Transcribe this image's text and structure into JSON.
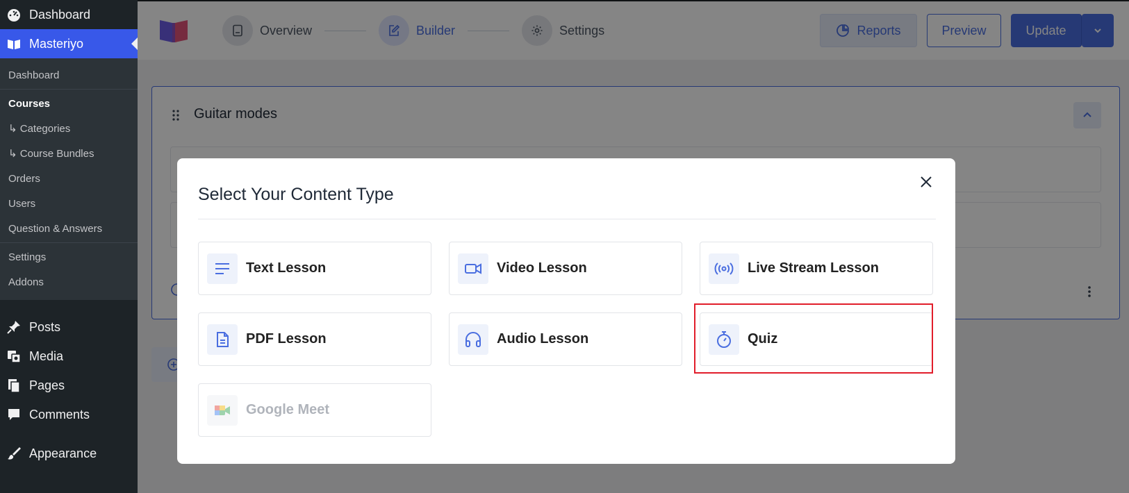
{
  "sidebar": {
    "top": [
      {
        "label": "Dashboard",
        "icon": "dashboard-icon"
      },
      {
        "label": "Masteriyo",
        "icon": "book-icon",
        "current": true
      }
    ],
    "submenu": [
      {
        "label": "Dashboard"
      },
      {
        "label": "Courses",
        "active": true
      },
      {
        "label": "↳ Categories"
      },
      {
        "label": "↳ Course Bundles"
      },
      {
        "label": "Orders"
      },
      {
        "label": "Users"
      },
      {
        "label": "Question & Answers"
      },
      {
        "label": "Settings"
      },
      {
        "label": "Addons"
      }
    ],
    "bottom": [
      {
        "label": "Posts",
        "icon": "pin-icon"
      },
      {
        "label": "Media",
        "icon": "media-icon"
      },
      {
        "label": "Pages",
        "icon": "pages-icon"
      },
      {
        "label": "Comments",
        "icon": "comment-icon"
      },
      {
        "label": "Appearance",
        "icon": "brush-icon"
      }
    ]
  },
  "header": {
    "steps": [
      {
        "label": "Overview",
        "icon": "document-icon"
      },
      {
        "label": "Builder",
        "icon": "edit-icon",
        "active": true
      },
      {
        "label": "Settings",
        "icon": "gear-icon"
      }
    ],
    "reports_label": "Reports",
    "preview_label": "Preview",
    "update_label": "Update"
  },
  "builder": {
    "section_title": "Guitar modes"
  },
  "modal": {
    "title": "Select Your Content Type",
    "options": [
      {
        "label": "Text Lesson",
        "icon": "text-lines-icon"
      },
      {
        "label": "Video Lesson",
        "icon": "video-camera-icon"
      },
      {
        "label": "Live Stream Lesson",
        "icon": "broadcast-icon"
      },
      {
        "label": "PDF Lesson",
        "icon": "pdf-file-icon"
      },
      {
        "label": "Audio Lesson",
        "icon": "headphones-icon"
      },
      {
        "label": "Quiz",
        "icon": "stopwatch-icon",
        "highlighted": true
      },
      {
        "label": "Google Meet",
        "icon": "google-meet-icon",
        "disabled": true
      }
    ]
  },
  "colors": {
    "accent": "#4a6ee0",
    "wp_sidebar": "#1d2327",
    "wp_current": "#3858e9",
    "highlight": "#e11d2a"
  }
}
